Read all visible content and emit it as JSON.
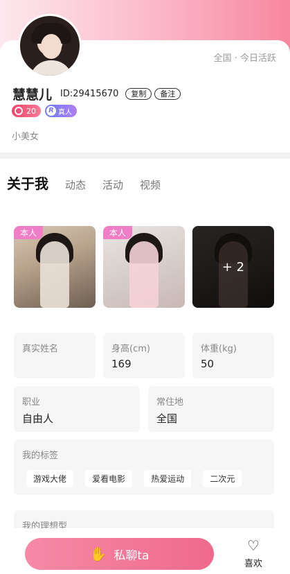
{
  "profile": {
    "region_status": "全国 · 今日活跃",
    "name": "慧慧儿",
    "uid": "ID:29415670",
    "copy_label": "复制",
    "note_label": "备注",
    "level": "20",
    "real_badge": "真人",
    "real_badge_icon_letter": "R",
    "bio": "小美女"
  },
  "tabs": [
    "关于我",
    "动态",
    "活动",
    "视频"
  ],
  "photos": {
    "self_tag": "本人",
    "more_count": "+ 2"
  },
  "info": {
    "real_name_label": "真实姓名",
    "real_name_value": "",
    "height_label": "身高(cm)",
    "height_value": "169",
    "weight_label": "体重(kg)",
    "weight_value": "50",
    "job_label": "职业",
    "job_value": "自由人",
    "residence_label": "常住地",
    "residence_value": "全国",
    "tags_label": "我的标签",
    "tags": [
      "游戏大佬",
      "爱看电影",
      "热爱运动",
      "二次元"
    ],
    "ideal_label": "我的理想型"
  },
  "bottom": {
    "chat_label": "私聊ta",
    "like_label": "喜欢"
  },
  "colors": {
    "accent_pink": "#f06a8c",
    "tag_pink": "#f07ec6",
    "real_badge": "#7a78f4"
  }
}
